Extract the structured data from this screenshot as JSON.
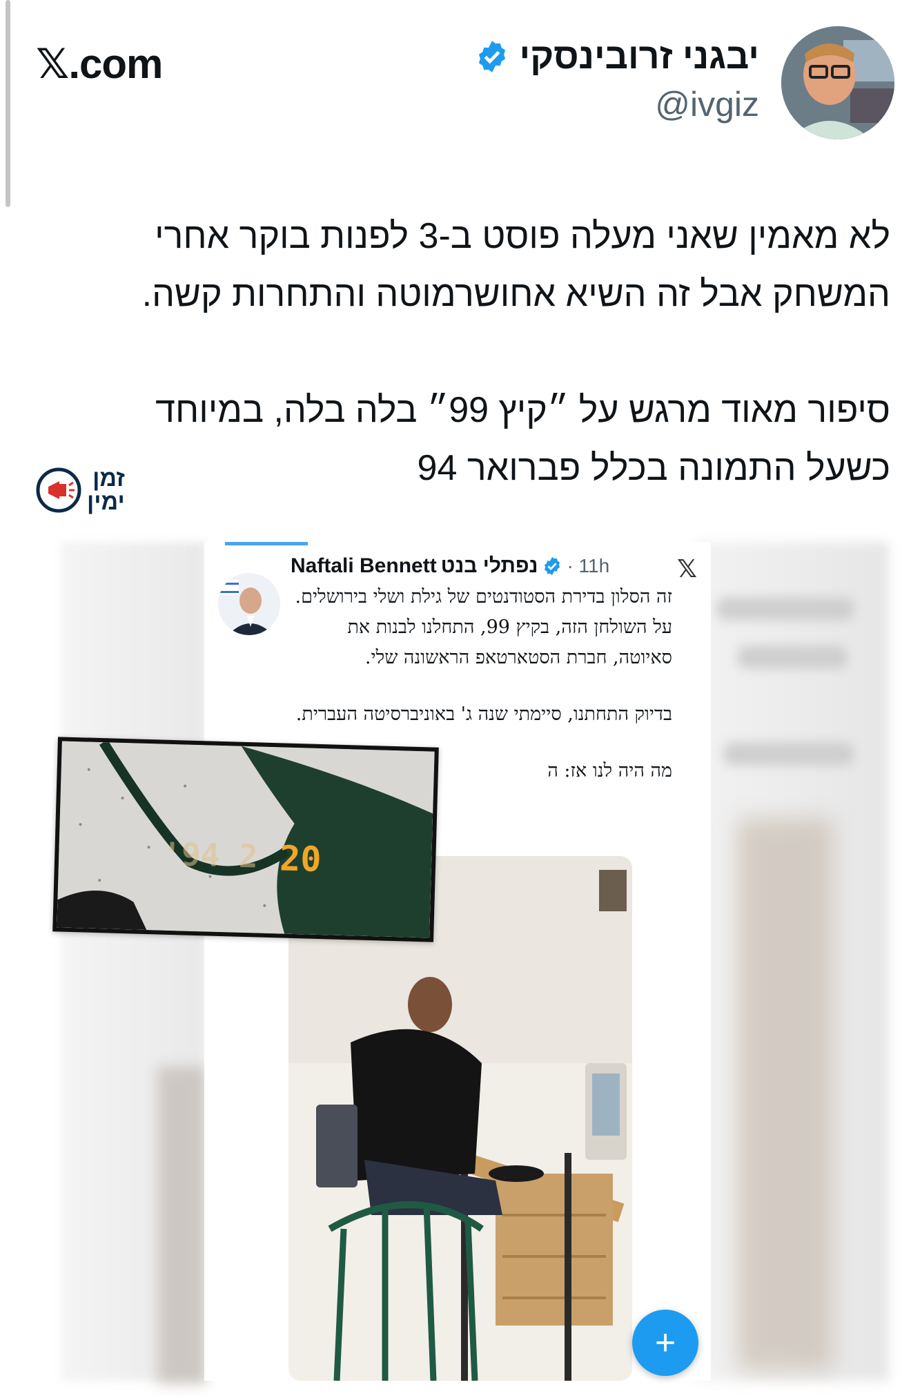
{
  "site": {
    "label": "𝕏.com"
  },
  "author": {
    "name": "יבגני זרובינסקי",
    "handle": "@ivgiz",
    "verified": true,
    "verified_color": "#1d9bf0"
  },
  "tweet": {
    "paragraphs": [
      "לא מאמין שאני מעלה פוסט ב-3 לפנות בוקר אחרי\nהמשחק אבל זה השיא אחושרמוטה והתחרות קשה.",
      "סיפור מאוד מרגש על ״קיץ 99״ בלה בלה, במיוחד\nכשעל התמונה בכלל פברואר 94"
    ]
  },
  "watermark": {
    "line1": "זמן",
    "line2": "ימין"
  },
  "embedded_post": {
    "name_en": "Naftali Bennett",
    "name_he": "נפתלי בנט",
    "time": "· 11h",
    "x_icon": "𝕏",
    "paragraphs": [
      "זה הסלון בדירת הסטודנטים של גילת ושלי בירושלים. על השולחן הזה, בקיץ 99, התחלנו לבנות את סאיוטה, חברת הסטארטאפ הראשונה שלי.",
      "בדיוק התחתנו, סיימתי שנה ג' באוניברסיטה העברית.",
      "מה היה לנו אז: ה"
    ],
    "photo_date_stamp": "'94 2 20"
  },
  "fab": {
    "label": "+"
  }
}
